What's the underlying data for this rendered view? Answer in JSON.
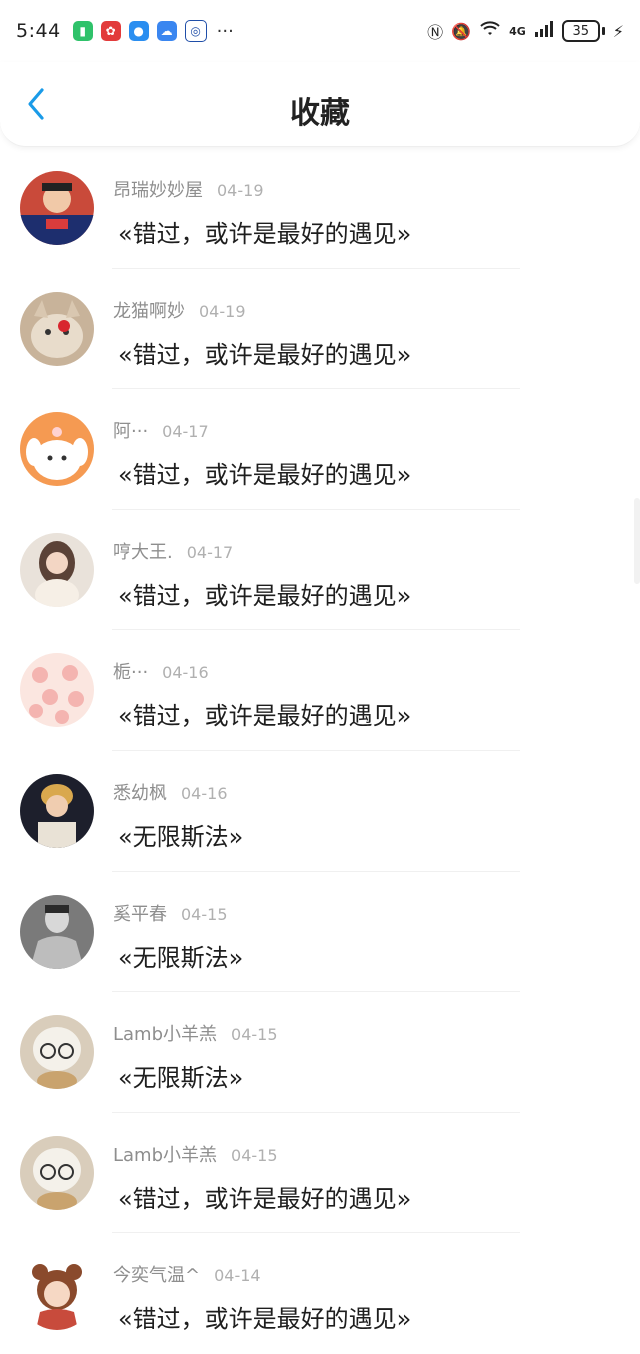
{
  "status_bar": {
    "time": "5:44",
    "notification_icons": [
      "phone-app-icon",
      "huawei-app-icon",
      "message-app-icon",
      "cloud-app-icon",
      "bank-app-icon"
    ],
    "more": "···",
    "network": "4G",
    "battery_level": "35"
  },
  "header": {
    "back": "back-arrow-icon",
    "title": "收藏",
    "accent_color": "#1a9be8"
  },
  "items": [
    {
      "user": "昂瑞妙妙屋",
      "date": "04-19",
      "text": "«错过，或许是最好的遇见»"
    },
    {
      "user": "龙猫啊妙",
      "date": "04-19",
      "text": "«错过，或许是最好的遇见»"
    },
    {
      "user": "阿···",
      "date": "04-17",
      "text": "«错过，或许是最好的遇见»"
    },
    {
      "user": "哼大王.",
      "date": "04-17",
      "text": "«错过，或许是最好的遇见»"
    },
    {
      "user": "栀···",
      "date": "04-16",
      "text": "«错过，或许是最好的遇见»"
    },
    {
      "user": "悉幼枫",
      "date": "04-16",
      "text": "«无限斯法»"
    },
    {
      "user": "奚平春",
      "date": "04-15",
      "text": "«无限斯法»"
    },
    {
      "user": "Lamb小羊羔",
      "date": "04-15",
      "text": "«无限斯法»"
    },
    {
      "user": "Lamb小羊羔",
      "date": "04-15",
      "text": "«错过，或许是最好的遇见»"
    },
    {
      "user": "今奕气温^",
      "date": "04-14",
      "text": "«错过，或许是最好的遇见»"
    }
  ]
}
